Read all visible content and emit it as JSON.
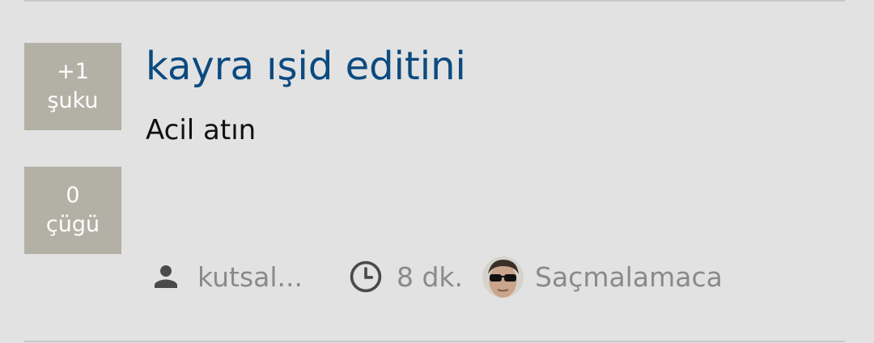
{
  "post": {
    "title": "kayra ışid editini",
    "body": "Acil atın"
  },
  "votes": {
    "up": {
      "count": "+1",
      "label": "şuku"
    },
    "down": {
      "count": "0",
      "label": "çügü"
    }
  },
  "meta": {
    "author": "kutsal...",
    "time": "8 dk.",
    "channel": "Saçmalamaca",
    "icons": {
      "author": "person-icon",
      "time": "clock-icon",
      "channel": "channel-avatar"
    }
  },
  "colors": {
    "background": "#e2e2e2",
    "title": "#0c4a80",
    "vote_box": "#b3b1a5",
    "meta_text": "#8a8a8a"
  }
}
